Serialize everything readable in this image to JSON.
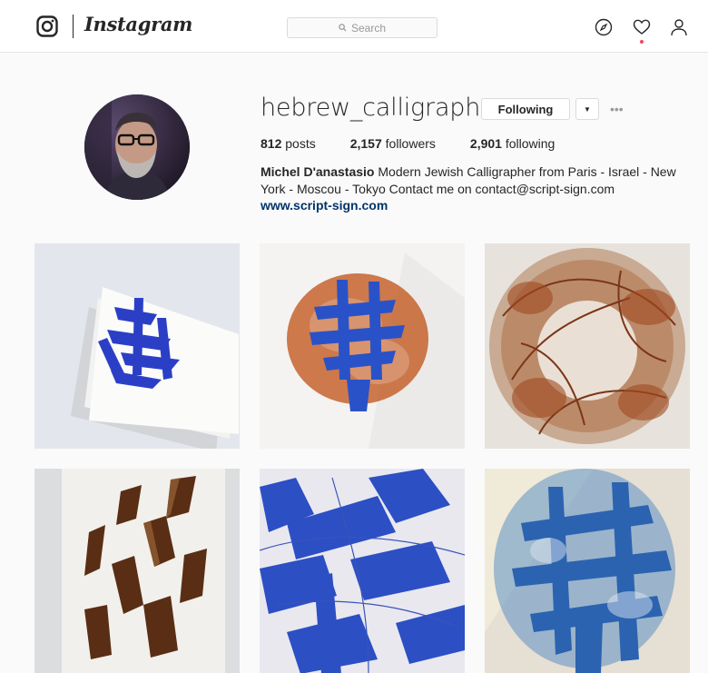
{
  "nav": {
    "wordmark": "Instagram",
    "search_placeholder": "Search",
    "icons": [
      "instagram-glyph-icon",
      "search-icon",
      "compass-icon",
      "heart-icon",
      "person-icon"
    ],
    "notification_dot_color": "#ed4956"
  },
  "profile": {
    "username": "hebrew_calligrapher",
    "follow_button": "Following",
    "dropdown_glyph": "▼",
    "more_glyph": "•••",
    "stats": [
      {
        "value": "812",
        "label": "posts"
      },
      {
        "value": "2,157",
        "label": "followers"
      },
      {
        "value": "2,901",
        "label": "following"
      }
    ],
    "full_name": "Michel D'anastasio",
    "bio_text": "Modern Jewish Calligrapher from Paris - Israel - New York - Moscou - Tokyo Contact me on contact@script-sign.com",
    "website": "www.script-sign.com"
  },
  "posts": [
    {
      "name": "blue calligraphy on white card stack"
    },
    {
      "name": "blue letters over orange splash"
    },
    {
      "name": "rust ink circular brush strokes"
    },
    {
      "name": "brown bronze hebrew letters"
    },
    {
      "name": "large blue hebrew strokes close-up"
    },
    {
      "name": "blue textured hebrew letters"
    }
  ],
  "colors": {
    "link": "#003569",
    "text": "#262626",
    "muted": "#999999",
    "border": "#dbdbdb",
    "background": "#fafafa"
  }
}
